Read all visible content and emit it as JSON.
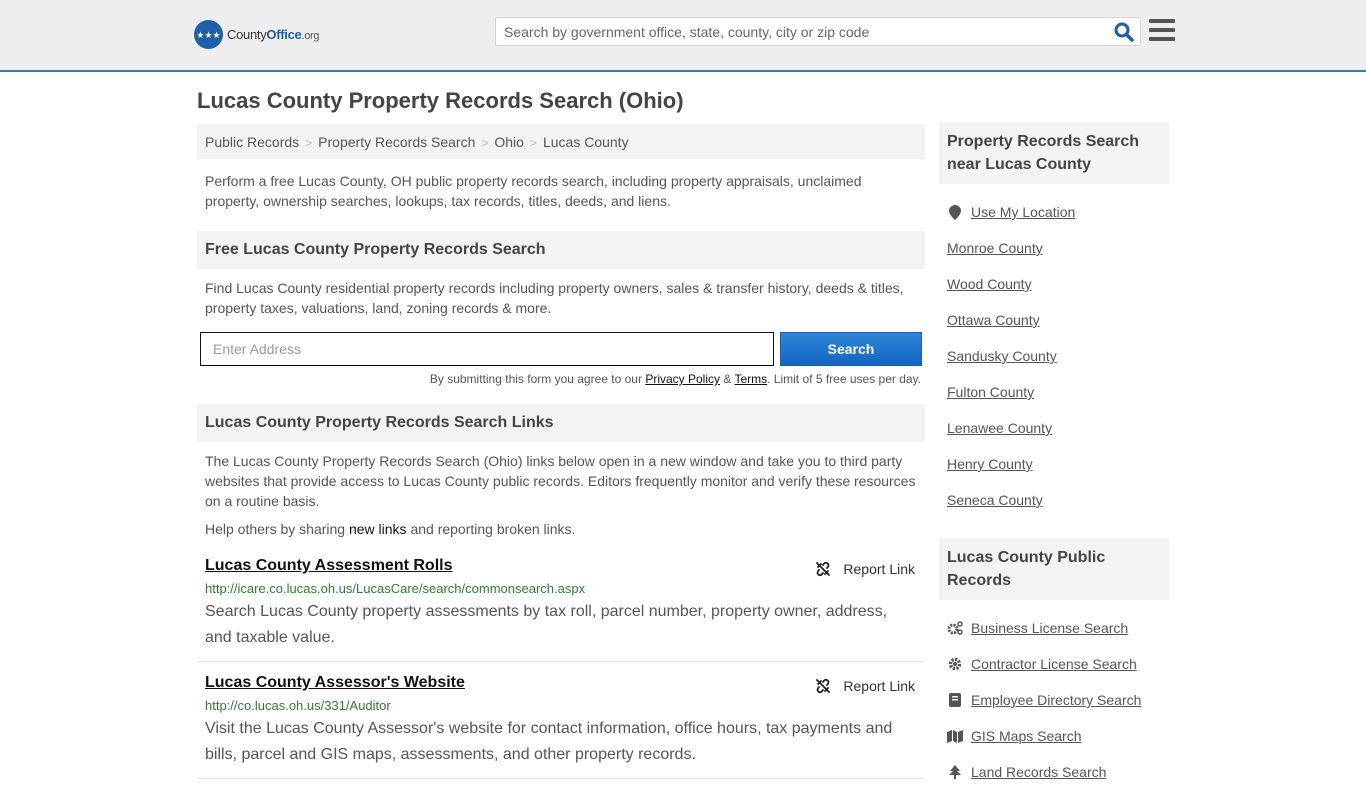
{
  "header": {
    "logo": {
      "name_plain": "County",
      "name_accent": "Office",
      "tld": ".org"
    },
    "search": {
      "placeholder": "Search by government office, state, county, city or zip code",
      "value": ""
    },
    "accent_color": "#3a7cb0"
  },
  "page": {
    "title": "Lucas County Property Records Search (Ohio)"
  },
  "breadcrumb": [
    {
      "label": "Public Records"
    },
    {
      "label": "Property Records Search"
    },
    {
      "label": "Ohio"
    },
    {
      "label": "Lucas County"
    }
  ],
  "breadcrumb_separator": ">",
  "intro": "Perform a free Lucas County, OH public property records search, including property appraisals, unclaimed property, ownership searches, lookups, tax records, titles, deeds, and liens.",
  "free_search": {
    "heading": "Free Lucas County Property Records Search",
    "description": "Find Lucas County residential property records including property owners, sales & transfer history, deeds & titles, property taxes, valuations, land, zoning records & more.",
    "address_placeholder": "Enter Address",
    "address_value": "",
    "button_label": "Search",
    "disclaimer_prefix": "By submitting this form you agree to our ",
    "privacy_label": "Privacy Policy",
    "amp": " & ",
    "terms_label": "Terms",
    "disclaimer_suffix": ". Limit of 5 free uses per day."
  },
  "links_section": {
    "heading": "Lucas County Property Records Search Links",
    "description": "The Lucas County Property Records Search (Ohio) links below open in a new window and take you to third party websites that provide access to Lucas County public records. Editors frequently monitor and verify these resources on a routine basis.",
    "help_prefix": "Help others by sharing ",
    "help_link": "new links",
    "help_suffix": " and reporting broken links.",
    "report_label": "Report Link",
    "items": [
      {
        "title": "Lucas County Assessment Rolls",
        "url": "http://icare.co.lucas.oh.us/LucasCare/search/commonsearch.aspx",
        "description": "Search Lucas County property assessments by tax roll, parcel number, property owner, address, and taxable value."
      },
      {
        "title": "Lucas County Assessor's Website",
        "url": "http://co.lucas.oh.us/331/Auditor",
        "description": "Visit the Lucas County Assessor's website for contact information, office hours, tax payments and bills, parcel and GIS maps, assessments, and other property records."
      }
    ]
  },
  "sidebar": {
    "nearby": {
      "heading": "Property Records Search near Lucas County",
      "use_location": "Use My Location",
      "counties": [
        "Monroe County",
        "Wood County",
        "Ottawa County",
        "Sandusky County",
        "Fulton County",
        "Lenawee County",
        "Henry County",
        "Seneca County"
      ]
    },
    "public_records": {
      "heading": "Lucas County Public Records",
      "items": [
        {
          "label": "Business License Search",
          "icon": "gears-icon"
        },
        {
          "label": "Contractor License Search",
          "icon": "gear-icon"
        },
        {
          "label": "Employee Directory Search",
          "icon": "book-icon"
        },
        {
          "label": "GIS Maps Search",
          "icon": "map-icon"
        },
        {
          "label": "Land Records Search",
          "icon": "tree-icon"
        }
      ]
    }
  }
}
